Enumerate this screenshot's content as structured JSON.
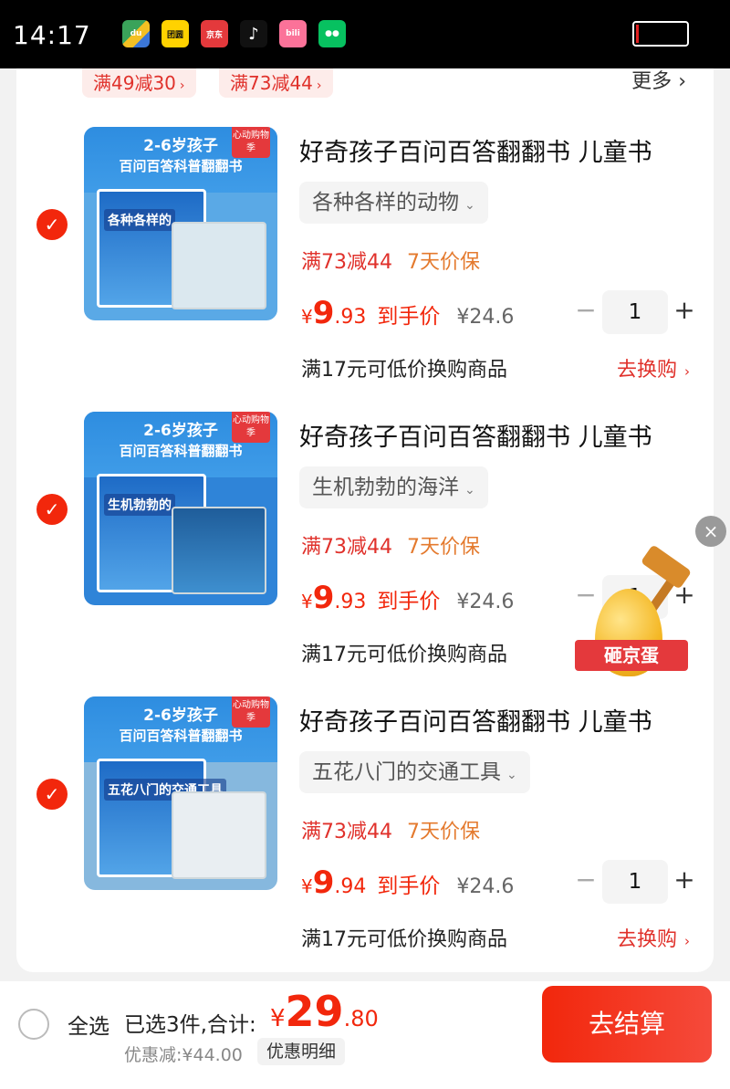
{
  "status_bar": {
    "time": "14:17",
    "app_icons": [
      {
        "name": "map-app",
        "label": "du"
      },
      {
        "name": "meituan-app",
        "label": "团圆"
      },
      {
        "name": "jd-app",
        "label": "京东"
      },
      {
        "name": "tiktok-app",
        "label": "♪"
      },
      {
        "name": "bilibili-app",
        "label": "bili"
      },
      {
        "name": "wechat-app",
        "label": "●●"
      }
    ],
    "battery_level": 0.05,
    "battery_color": "#e02020"
  },
  "store_coupons": {
    "items": [
      "满49减30",
      "满73减44"
    ],
    "more_label": "更多"
  },
  "cart_items": [
    {
      "thumb_headline": "2-6岁孩子",
      "thumb_subline": "百问百答科普翻翻书",
      "thumb_tag": "心动购物季",
      "thumb_volume": "各种各样的",
      "title": "好奇孩子百问百答翻翻书 儿童书",
      "variant": "各种各样的动物",
      "promo": "满73减44",
      "guarantee": "7天价保",
      "price_int": "9",
      "price_dec": ".93",
      "price_label": "到手价",
      "original_price": "¥24.6",
      "quantity": "1",
      "swap_text": "满17元可低价换购商品",
      "swap_link": "去换购"
    },
    {
      "thumb_headline": "2-6岁孩子",
      "thumb_subline": "百问百答科普翻翻书",
      "thumb_tag": "心动购物季",
      "thumb_volume": "生机勃勃的",
      "title": "好奇孩子百问百答翻翻书 儿童书",
      "variant": "生机勃勃的海洋",
      "promo": "满73减44",
      "guarantee": "7天价保",
      "price_int": "9",
      "price_dec": ".93",
      "price_label": "到手价",
      "original_price": "¥24.6",
      "quantity": "1",
      "swap_text": "满17元可低价换购商品",
      "swap_link": ""
    },
    {
      "thumb_headline": "2-6岁孩子",
      "thumb_subline": "百问百答科普翻翻书",
      "thumb_tag": "心动购物季",
      "thumb_volume": "五花八门的交通工具",
      "title": "好奇孩子百问百答翻翻书 儿童书",
      "variant": "五花八门的交通工具",
      "promo": "满73减44",
      "guarantee": "7天价保",
      "price_int": "9",
      "price_dec": ".94",
      "price_label": "到手价",
      "original_price": "¥24.6",
      "quantity": "1",
      "swap_text": "满17元可低价换购商品",
      "swap_link": "去换购"
    }
  ],
  "egg_widget": {
    "label": "砸京蛋",
    "close": "×"
  },
  "bottom_bar": {
    "select_all": "全选",
    "selected_text": "已选3件,合计:",
    "currency": "¥",
    "total_int": "29",
    "total_dec": ".80",
    "discount_text": "优惠减:¥44.00",
    "discount_detail": "优惠明细",
    "checkout_label": "去结算"
  },
  "colors": {
    "accent": "#f2270c",
    "promo_text": "#e0312b",
    "guarantee_text": "#e47a2e"
  }
}
